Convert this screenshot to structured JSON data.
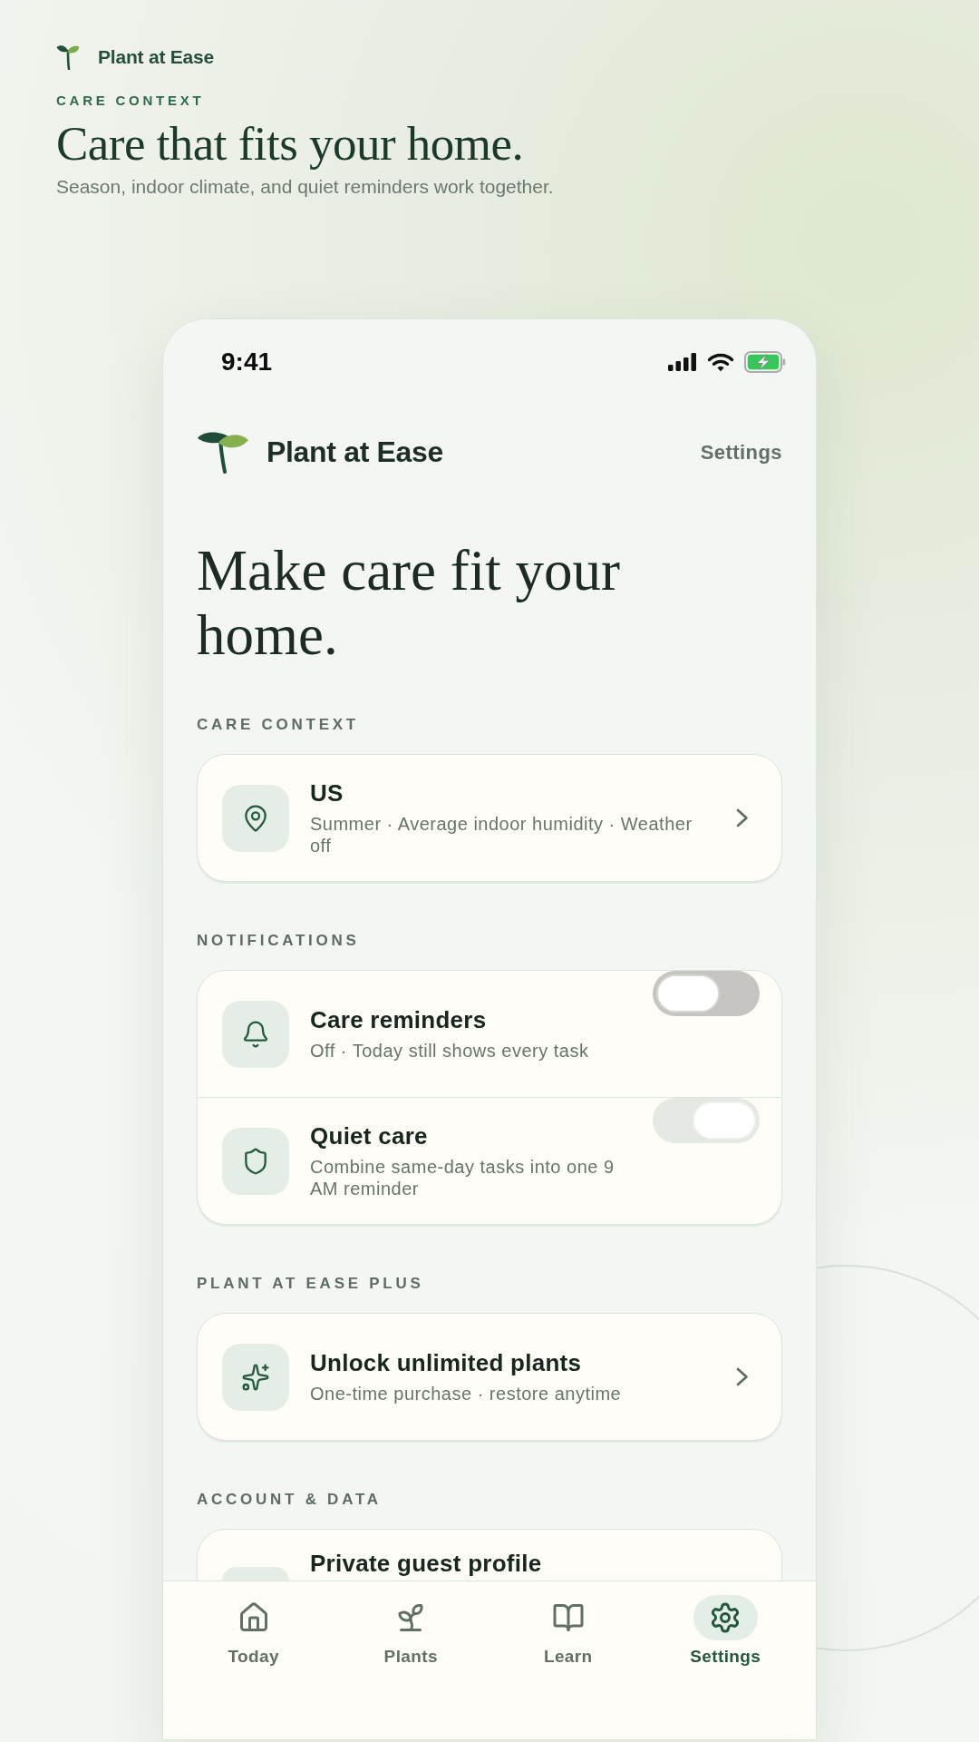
{
  "brand": {
    "name": "Plant at Ease"
  },
  "hero": {
    "eyebrow": "CARE CONTEXT",
    "title": "Care that fits your home.",
    "subtitle": "Season, indoor climate, and quiet reminders work together."
  },
  "phone": {
    "status_bar": {
      "time": "9:41"
    },
    "app_bar": {
      "title": "Plant at Ease",
      "action": "Settings"
    },
    "heading": "Make care fit your home.",
    "sections": [
      {
        "label": "CARE CONTEXT",
        "rows": [
          {
            "kind": "link",
            "title": "US",
            "subtitle": "Summer · Average indoor humidity · Weather off"
          }
        ]
      },
      {
        "label": "NOTIFICATIONS",
        "rows": [
          {
            "kind": "toggle",
            "title": "Care reminders",
            "subtitle": "Off · Today still shows every task",
            "on": false
          },
          {
            "kind": "toggle",
            "title": "Quiet care",
            "subtitle": "Combine same-day tasks into one 9 AM reminder",
            "on": true
          }
        ]
      },
      {
        "label": "PLANT AT EASE PLUS",
        "rows": [
          {
            "kind": "link",
            "title": "Unlock unlimited plants",
            "subtitle": "One-time purchase · restore anytime"
          }
        ]
      },
      {
        "label": "ACCOUNT & DATA",
        "rows": [
          {
            "kind": "plain",
            "title": "Private guest profile"
          }
        ]
      }
    ],
    "tab_bar": [
      {
        "label": "Today",
        "selected": false
      },
      {
        "label": "Plants",
        "selected": false
      },
      {
        "label": "Learn",
        "selected": false
      },
      {
        "label": "Settings",
        "selected": true
      }
    ]
  }
}
